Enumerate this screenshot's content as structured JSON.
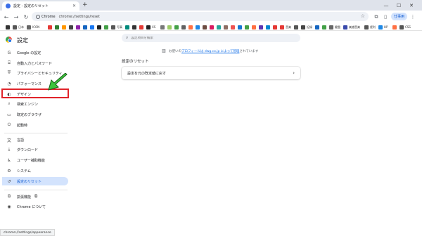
{
  "browser": {
    "tab_title": "設定 - 設定のリセット",
    "new_tab": "+",
    "omnibox_chip": "Chrome",
    "url": "chrome://settings/reset",
    "profile_label": "仕事用",
    "status_url": "chrome://settings/appearance",
    "window_controls": [
      "—",
      "☐",
      "✕"
    ]
  },
  "bookmarks": [
    {
      "label": "",
      "color": "#333333"
    },
    {
      "label": "日本",
      "color": "#555555"
    },
    {
      "label": "ICON",
      "color": "#666666"
    },
    {
      "label": "",
      "color": "#e53935"
    },
    {
      "label": "",
      "color": "#2e7d32"
    },
    {
      "label": "",
      "color": "#ff9800"
    },
    {
      "label": "",
      "color": "#444444"
    },
    {
      "label": "",
      "color": "#8e24aa"
    },
    {
      "label": "",
      "color": "#1565c0"
    },
    {
      "label": "",
      "color": "#1877f2"
    },
    {
      "label": "",
      "color": "#212121"
    },
    {
      "label": "",
      "color": "#43a047"
    },
    {
      "label": "写真",
      "color": "#555555"
    },
    {
      "label": "",
      "color": "#00897b"
    },
    {
      "label": "",
      "color": "#333333"
    },
    {
      "label": "",
      "color": "#e53935"
    },
    {
      "label": "XS",
      "color": "#222222"
    },
    {
      "label": "",
      "color": "#777777"
    },
    {
      "label": "",
      "color": "#9ccc65"
    },
    {
      "label": "",
      "color": "#43a047"
    },
    {
      "label": "",
      "color": "#616161"
    },
    {
      "label": "",
      "color": "#ff7043"
    },
    {
      "label": "",
      "color": "#1e88e5"
    },
    {
      "label": "",
      "color": "#6d4c41"
    },
    {
      "label": "",
      "color": "#d81b60"
    },
    {
      "label": "",
      "color": "#26a69a"
    },
    {
      "label": "",
      "color": "#8d6e63"
    },
    {
      "label": "",
      "color": "#ef5350"
    },
    {
      "label": "",
      "color": "#1976d2"
    },
    {
      "label": "",
      "color": "#43a047"
    },
    {
      "label": "",
      "color": "#ff7043"
    },
    {
      "label": "",
      "color": "#5e35b1"
    },
    {
      "label": "",
      "color": "#0288d1"
    },
    {
      "label": "",
      "color": "#e53935"
    },
    {
      "label": "音楽",
      "color": "#e53935"
    },
    {
      "label": "",
      "color": "#555555"
    },
    {
      "label": "記録",
      "color": "#444444"
    },
    {
      "label": "",
      "color": "#1565c0"
    },
    {
      "label": "",
      "color": "#43a047"
    },
    {
      "label": "鍵盤",
      "color": "#666666"
    },
    {
      "label": "楽譜音楽",
      "color": "#3949ab"
    },
    {
      "label": "便利",
      "color": "#555555"
    },
    {
      "label": "HP",
      "color": "#1e88e5"
    },
    {
      "label": "",
      "color": "#ff7043"
    },
    {
      "label": "CSS",
      "color": "#555555"
    }
  ],
  "settings": {
    "title": "設定",
    "search_placeholder": "設定項目を検索",
    "nav": [
      {
        "label": "Google の設定",
        "icon": "G"
      },
      {
        "label": "自動入力とパスワード",
        "icon": "⌸"
      },
      {
        "label": "プライバシーとセキュリティ",
        "icon": "⛨"
      },
      {
        "label": "パフォーマンス",
        "icon": "◔"
      },
      {
        "label": "デザイン",
        "icon": "◐"
      },
      {
        "label": "検索エンジン",
        "icon": "⌕"
      },
      {
        "label": "既定のブラウザ",
        "icon": "▭"
      },
      {
        "label": "起動時",
        "icon": "⏻"
      },
      {
        "label": "言語",
        "icon": "文"
      },
      {
        "label": "ダウンロード",
        "icon": "⤓"
      },
      {
        "label": "ユーザー補助機能",
        "icon": "♿"
      },
      {
        "label": "システム",
        "icon": "⚙"
      },
      {
        "label": "設定のリセット",
        "icon": "↺"
      },
      {
        "label": "拡張機能",
        "icon": "⧉"
      },
      {
        "label": "Chrome について",
        "icon": "◉"
      }
    ],
    "notice_prefix": "お使いの",
    "notice_link": "プロフィールは dwg.co.jp によって管理",
    "notice_suffix": "されています",
    "section_title": "設定のリセット",
    "card_label": "設定を元の既定値に戻す"
  },
  "colors": {
    "active_bg": "#d3e3fd",
    "accent": "#0b57d0",
    "highlight": "#e0242a",
    "arrow": "#3cc43c"
  }
}
